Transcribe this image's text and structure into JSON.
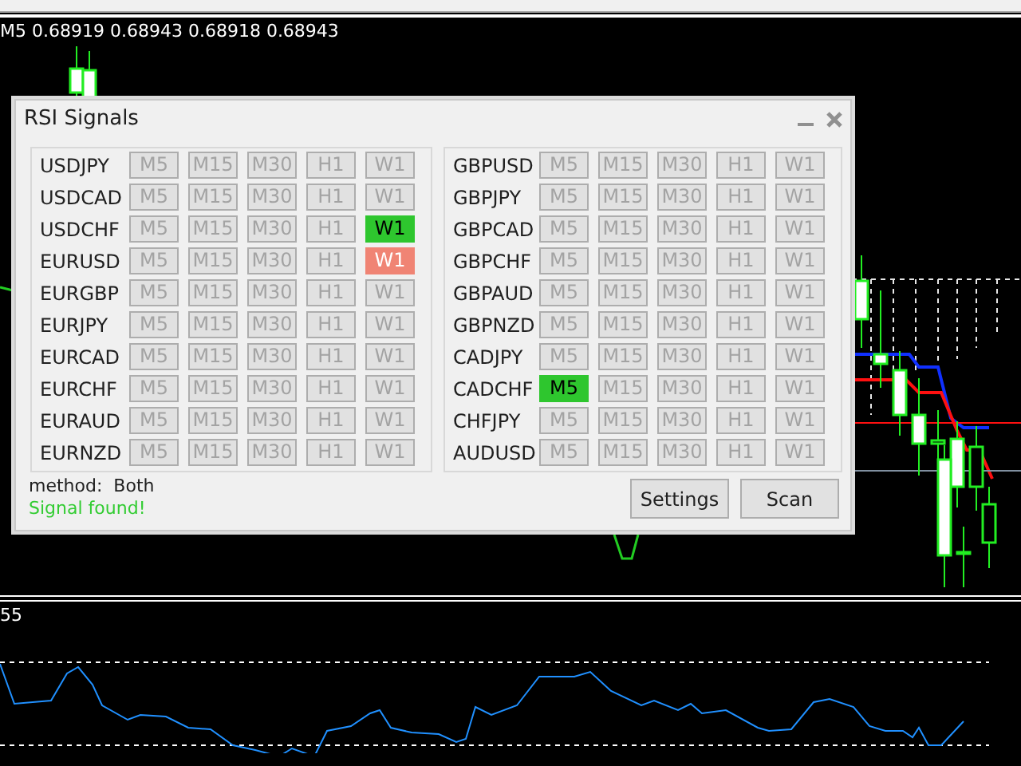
{
  "chart_header": "M5  0.68919 0.68943 0.68918 0.68943",
  "indicator_label": "55",
  "window": {
    "title": "RSI Signals"
  },
  "panels": [
    {
      "rows": [
        {
          "pair": "USDJPY",
          "cells": [
            {
              "label": "M5",
              "kind": "off"
            },
            {
              "label": "M15",
              "kind": "off"
            },
            {
              "label": "M30",
              "kind": "off"
            },
            {
              "label": "H1",
              "kind": "off"
            },
            {
              "label": "W1",
              "kind": "off"
            }
          ]
        },
        {
          "pair": "USDCAD",
          "cells": [
            {
              "label": "M5",
              "kind": "off"
            },
            {
              "label": "M15",
              "kind": "off"
            },
            {
              "label": "M30",
              "kind": "off"
            },
            {
              "label": "H1",
              "kind": "off"
            },
            {
              "label": "W1",
              "kind": "off"
            }
          ]
        },
        {
          "pair": "USDCHF",
          "cells": [
            {
              "label": "M5",
              "kind": "off"
            },
            {
              "label": "M15",
              "kind": "off"
            },
            {
              "label": "M30",
              "kind": "off"
            },
            {
              "label": "H1",
              "kind": "off"
            },
            {
              "label": "W1",
              "kind": "up"
            }
          ]
        },
        {
          "pair": "EURUSD",
          "cells": [
            {
              "label": "M5",
              "kind": "off"
            },
            {
              "label": "M15",
              "kind": "off"
            },
            {
              "label": "M30",
              "kind": "off"
            },
            {
              "label": "H1",
              "kind": "off"
            },
            {
              "label": "W1",
              "kind": "down"
            }
          ]
        },
        {
          "pair": "EURGBP",
          "cells": [
            {
              "label": "M5",
              "kind": "off"
            },
            {
              "label": "M15",
              "kind": "off"
            },
            {
              "label": "M30",
              "kind": "off"
            },
            {
              "label": "H1",
              "kind": "off"
            },
            {
              "label": "W1",
              "kind": "off"
            }
          ]
        },
        {
          "pair": "EURJPY",
          "cells": [
            {
              "label": "M5",
              "kind": "off"
            },
            {
              "label": "M15",
              "kind": "off"
            },
            {
              "label": "M30",
              "kind": "off"
            },
            {
              "label": "H1",
              "kind": "off"
            },
            {
              "label": "W1",
              "kind": "off"
            }
          ]
        },
        {
          "pair": "EURCAD",
          "cells": [
            {
              "label": "M5",
              "kind": "off"
            },
            {
              "label": "M15",
              "kind": "off"
            },
            {
              "label": "M30",
              "kind": "off"
            },
            {
              "label": "H1",
              "kind": "off"
            },
            {
              "label": "W1",
              "kind": "off"
            }
          ]
        },
        {
          "pair": "EURCHF",
          "cells": [
            {
              "label": "M5",
              "kind": "off"
            },
            {
              "label": "M15",
              "kind": "off"
            },
            {
              "label": "M30",
              "kind": "off"
            },
            {
              "label": "H1",
              "kind": "off"
            },
            {
              "label": "W1",
              "kind": "off"
            }
          ]
        },
        {
          "pair": "EURAUD",
          "cells": [
            {
              "label": "M5",
              "kind": "off"
            },
            {
              "label": "M15",
              "kind": "off"
            },
            {
              "label": "M30",
              "kind": "off"
            },
            {
              "label": "H1",
              "kind": "off"
            },
            {
              "label": "W1",
              "kind": "off"
            }
          ]
        },
        {
          "pair": "EURNZD",
          "cells": [
            {
              "label": "M5",
              "kind": "off"
            },
            {
              "label": "M15",
              "kind": "off"
            },
            {
              "label": "M30",
              "kind": "off"
            },
            {
              "label": "H1",
              "kind": "off"
            },
            {
              "label": "W1",
              "kind": "off"
            }
          ]
        }
      ]
    },
    {
      "rows": [
        {
          "pair": "GBPUSD",
          "cells": [
            {
              "label": "M5",
              "kind": "off"
            },
            {
              "label": "M15",
              "kind": "off"
            },
            {
              "label": "M30",
              "kind": "off"
            },
            {
              "label": "H1",
              "kind": "off"
            },
            {
              "label": "W1",
              "kind": "off"
            }
          ]
        },
        {
          "pair": "GBPJPY",
          "cells": [
            {
              "label": "M5",
              "kind": "off"
            },
            {
              "label": "M15",
              "kind": "off"
            },
            {
              "label": "M30",
              "kind": "off"
            },
            {
              "label": "H1",
              "kind": "off"
            },
            {
              "label": "W1",
              "kind": "off"
            }
          ]
        },
        {
          "pair": "GBPCAD",
          "cells": [
            {
              "label": "M5",
              "kind": "off"
            },
            {
              "label": "M15",
              "kind": "off"
            },
            {
              "label": "M30",
              "kind": "off"
            },
            {
              "label": "H1",
              "kind": "off"
            },
            {
              "label": "W1",
              "kind": "off"
            }
          ]
        },
        {
          "pair": "GBPCHF",
          "cells": [
            {
              "label": "M5",
              "kind": "off"
            },
            {
              "label": "M15",
              "kind": "off"
            },
            {
              "label": "M30",
              "kind": "off"
            },
            {
              "label": "H1",
              "kind": "off"
            },
            {
              "label": "W1",
              "kind": "off"
            }
          ]
        },
        {
          "pair": "GBPAUD",
          "cells": [
            {
              "label": "M5",
              "kind": "off"
            },
            {
              "label": "M15",
              "kind": "off"
            },
            {
              "label": "M30",
              "kind": "off"
            },
            {
              "label": "H1",
              "kind": "off"
            },
            {
              "label": "W1",
              "kind": "off"
            }
          ]
        },
        {
          "pair": "GBPNZD",
          "cells": [
            {
              "label": "M5",
              "kind": "off"
            },
            {
              "label": "M15",
              "kind": "off"
            },
            {
              "label": "M30",
              "kind": "off"
            },
            {
              "label": "H1",
              "kind": "off"
            },
            {
              "label": "W1",
              "kind": "off"
            }
          ]
        },
        {
          "pair": "CADJPY",
          "cells": [
            {
              "label": "M5",
              "kind": "off"
            },
            {
              "label": "M15",
              "kind": "off"
            },
            {
              "label": "M30",
              "kind": "off"
            },
            {
              "label": "H1",
              "kind": "off"
            },
            {
              "label": "W1",
              "kind": "off"
            }
          ]
        },
        {
          "pair": "CADCHF",
          "cells": [
            {
              "label": "M5",
              "kind": "up"
            },
            {
              "label": "M15",
              "kind": "off"
            },
            {
              "label": "M30",
              "kind": "off"
            },
            {
              "label": "H1",
              "kind": "off"
            },
            {
              "label": "W1",
              "kind": "off"
            }
          ]
        },
        {
          "pair": "CHFJPY",
          "cells": [
            {
              "label": "M5",
              "kind": "off"
            },
            {
              "label": "M15",
              "kind": "off"
            },
            {
              "label": "M30",
              "kind": "off"
            },
            {
              "label": "H1",
              "kind": "off"
            },
            {
              "label": "W1",
              "kind": "off"
            }
          ]
        },
        {
          "pair": "AUDUSD",
          "cells": [
            {
              "label": "M5",
              "kind": "off"
            },
            {
              "label": "M15",
              "kind": "off"
            },
            {
              "label": "M30",
              "kind": "off"
            },
            {
              "label": "H1",
              "kind": "off"
            },
            {
              "label": "W1",
              "kind": "off"
            }
          ]
        }
      ]
    }
  ],
  "method": "method:  Both",
  "status": "Signal found!",
  "buttons": [
    "Settings",
    "Scan"
  ]
}
